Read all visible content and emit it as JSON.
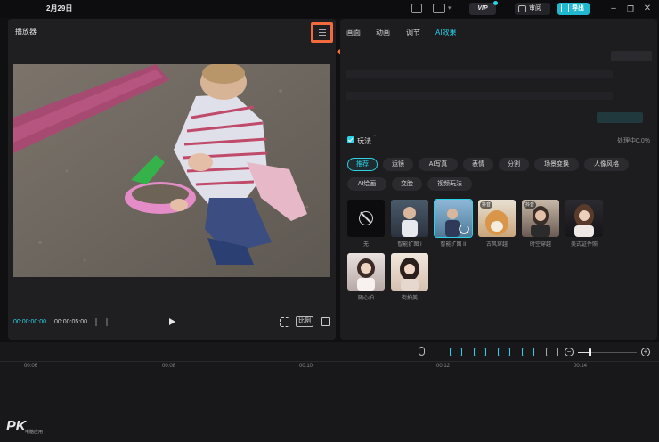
{
  "titlebar": {
    "date": "2月29日",
    "vip_label": "VIP",
    "review_label": "审阅",
    "export_label": "导出"
  },
  "player": {
    "title": "播放器",
    "current_time": "00:00:00:00",
    "duration": "00:00:05:00",
    "ratio_label": "比例"
  },
  "panel": {
    "tabs": [
      {
        "label": "画面",
        "active": false
      },
      {
        "label": "动画",
        "active": false
      },
      {
        "label": "调节",
        "active": false
      },
      {
        "label": "AI效果",
        "active": true
      }
    ],
    "play_label": "玩法",
    "processing": "处理中0.0%",
    "categories": [
      {
        "label": "推荐",
        "active": true
      },
      {
        "label": "运镜",
        "active": false
      },
      {
        "label": "AI写真",
        "active": false
      },
      {
        "label": "表情",
        "active": false
      },
      {
        "label": "分割",
        "active": false
      },
      {
        "label": "场景变换",
        "active": false
      },
      {
        "label": "人像风格",
        "active": false
      },
      {
        "label": "AI绘画",
        "active": false
      },
      {
        "label": "变脸",
        "active": false
      },
      {
        "label": "视频玩法",
        "active": false
      }
    ],
    "effects": [
      {
        "label": "无",
        "hot": ""
      },
      {
        "label": "智能扩图 I",
        "hot": ""
      },
      {
        "label": "智能扩图 II",
        "hot": ""
      },
      {
        "label": "古风穿越",
        "hot": "抖音"
      },
      {
        "label": "时空穿越",
        "hot": "抖音"
      },
      {
        "label": "美式证件照",
        "hot": ""
      },
      {
        "label": "随心拍",
        "hot": ""
      },
      {
        "label": "街拍美",
        "hot": ""
      }
    ]
  },
  "timeline": {
    "ticks": [
      "00:06",
      "00:08",
      "00:10",
      "00:12",
      "00:14"
    ],
    "zoom_level": 0.2
  },
  "watermark": {
    "brand": "PK",
    "sub": "电脑应用"
  },
  "colors": {
    "accent": "#2bd3e8",
    "highlight": "#f26a3d",
    "panel_bg": "#1d1d20"
  }
}
